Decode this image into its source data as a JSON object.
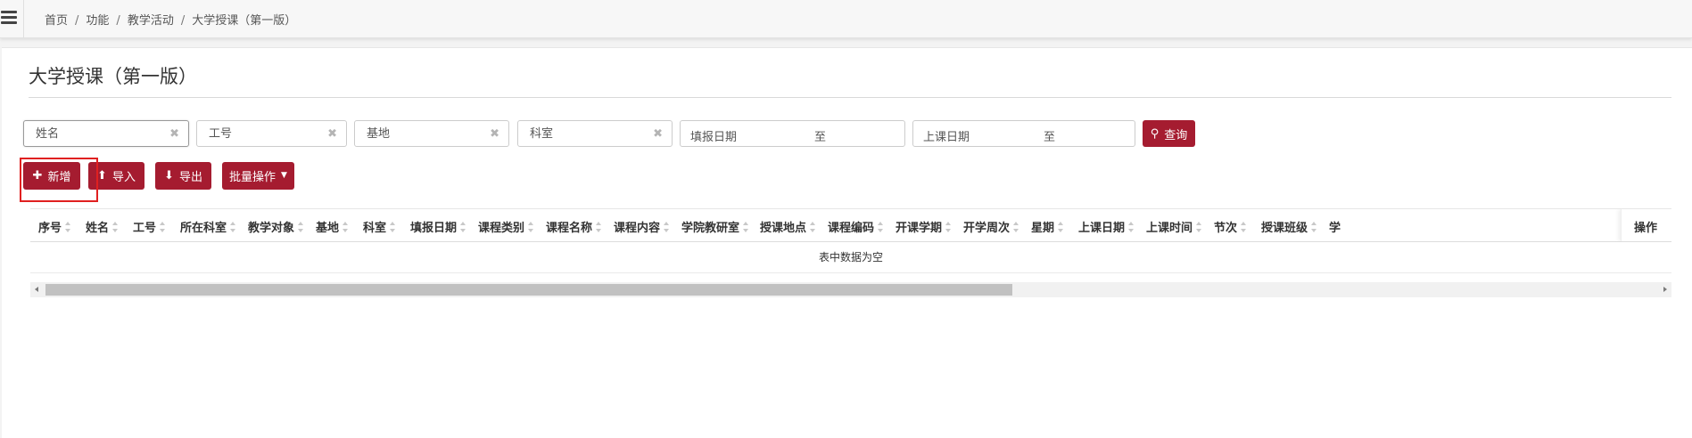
{
  "breadcrumb": [
    "首页",
    "功能",
    "教学活动",
    "大学授课（第一版）"
  ],
  "page_title": "大学授课（第一版）",
  "filters": {
    "name_placeholder": "姓名",
    "staff_no_placeholder": "工号",
    "base_placeholder": "基地",
    "dept_placeholder": "科室",
    "report_date_label": "填报日期",
    "report_date_to": "至",
    "class_date_label": "上课日期",
    "class_date_to": "至",
    "query_label": "查询"
  },
  "toolbar": {
    "add_label": "新增",
    "import_label": "导入",
    "export_label": "导出",
    "batch_label": "批量操作"
  },
  "table": {
    "columns": [
      "序号",
      "姓名",
      "工号",
      "所在科室",
      "教学对象",
      "基地",
      "科室",
      "填报日期",
      "课程类别",
      "课程名称",
      "课程内容",
      "学院教研室",
      "授课地点",
      "课程编码",
      "开课学期",
      "开学周次",
      "星期",
      "上课日期",
      "上课时间",
      "节次",
      "授课班级",
      "学"
    ],
    "action_column": "操作",
    "empty_text": "表中数据为空"
  },
  "scrollbar": {
    "visible_fraction": 0.6
  },
  "colors": {
    "primary": "#a51c30",
    "highlight": "#e02020"
  }
}
